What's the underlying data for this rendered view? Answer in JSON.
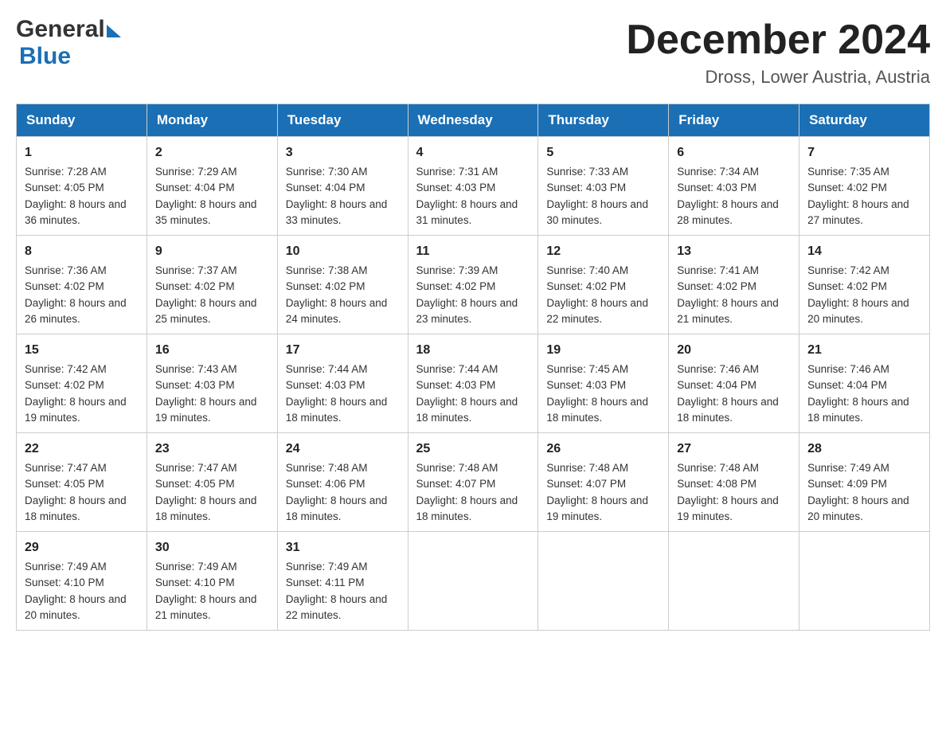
{
  "header": {
    "logo_general": "General",
    "logo_blue": "Blue",
    "title": "December 2024",
    "subtitle": "Dross, Lower Austria, Austria"
  },
  "days": [
    "Sunday",
    "Monday",
    "Tuesday",
    "Wednesday",
    "Thursday",
    "Friday",
    "Saturday"
  ],
  "weeks": [
    [
      {
        "num": "1",
        "sunrise": "7:28 AM",
        "sunset": "4:05 PM",
        "daylight": "8 hours and 36 minutes."
      },
      {
        "num": "2",
        "sunrise": "7:29 AM",
        "sunset": "4:04 PM",
        "daylight": "8 hours and 35 minutes."
      },
      {
        "num": "3",
        "sunrise": "7:30 AM",
        "sunset": "4:04 PM",
        "daylight": "8 hours and 33 minutes."
      },
      {
        "num": "4",
        "sunrise": "7:31 AM",
        "sunset": "4:03 PM",
        "daylight": "8 hours and 31 minutes."
      },
      {
        "num": "5",
        "sunrise": "7:33 AM",
        "sunset": "4:03 PM",
        "daylight": "8 hours and 30 minutes."
      },
      {
        "num": "6",
        "sunrise": "7:34 AM",
        "sunset": "4:03 PM",
        "daylight": "8 hours and 28 minutes."
      },
      {
        "num": "7",
        "sunrise": "7:35 AM",
        "sunset": "4:02 PM",
        "daylight": "8 hours and 27 minutes."
      }
    ],
    [
      {
        "num": "8",
        "sunrise": "7:36 AM",
        "sunset": "4:02 PM",
        "daylight": "8 hours and 26 minutes."
      },
      {
        "num": "9",
        "sunrise": "7:37 AM",
        "sunset": "4:02 PM",
        "daylight": "8 hours and 25 minutes."
      },
      {
        "num": "10",
        "sunrise": "7:38 AM",
        "sunset": "4:02 PM",
        "daylight": "8 hours and 24 minutes."
      },
      {
        "num": "11",
        "sunrise": "7:39 AM",
        "sunset": "4:02 PM",
        "daylight": "8 hours and 23 minutes."
      },
      {
        "num": "12",
        "sunrise": "7:40 AM",
        "sunset": "4:02 PM",
        "daylight": "8 hours and 22 minutes."
      },
      {
        "num": "13",
        "sunrise": "7:41 AM",
        "sunset": "4:02 PM",
        "daylight": "8 hours and 21 minutes."
      },
      {
        "num": "14",
        "sunrise": "7:42 AM",
        "sunset": "4:02 PM",
        "daylight": "8 hours and 20 minutes."
      }
    ],
    [
      {
        "num": "15",
        "sunrise": "7:42 AM",
        "sunset": "4:02 PM",
        "daylight": "8 hours and 19 minutes."
      },
      {
        "num": "16",
        "sunrise": "7:43 AM",
        "sunset": "4:03 PM",
        "daylight": "8 hours and 19 minutes."
      },
      {
        "num": "17",
        "sunrise": "7:44 AM",
        "sunset": "4:03 PM",
        "daylight": "8 hours and 18 minutes."
      },
      {
        "num": "18",
        "sunrise": "7:44 AM",
        "sunset": "4:03 PM",
        "daylight": "8 hours and 18 minutes."
      },
      {
        "num": "19",
        "sunrise": "7:45 AM",
        "sunset": "4:03 PM",
        "daylight": "8 hours and 18 minutes."
      },
      {
        "num": "20",
        "sunrise": "7:46 AM",
        "sunset": "4:04 PM",
        "daylight": "8 hours and 18 minutes."
      },
      {
        "num": "21",
        "sunrise": "7:46 AM",
        "sunset": "4:04 PM",
        "daylight": "8 hours and 18 minutes."
      }
    ],
    [
      {
        "num": "22",
        "sunrise": "7:47 AM",
        "sunset": "4:05 PM",
        "daylight": "8 hours and 18 minutes."
      },
      {
        "num": "23",
        "sunrise": "7:47 AM",
        "sunset": "4:05 PM",
        "daylight": "8 hours and 18 minutes."
      },
      {
        "num": "24",
        "sunrise": "7:48 AM",
        "sunset": "4:06 PM",
        "daylight": "8 hours and 18 minutes."
      },
      {
        "num": "25",
        "sunrise": "7:48 AM",
        "sunset": "4:07 PM",
        "daylight": "8 hours and 18 minutes."
      },
      {
        "num": "26",
        "sunrise": "7:48 AM",
        "sunset": "4:07 PM",
        "daylight": "8 hours and 19 minutes."
      },
      {
        "num": "27",
        "sunrise": "7:48 AM",
        "sunset": "4:08 PM",
        "daylight": "8 hours and 19 minutes."
      },
      {
        "num": "28",
        "sunrise": "7:49 AM",
        "sunset": "4:09 PM",
        "daylight": "8 hours and 20 minutes."
      }
    ],
    [
      {
        "num": "29",
        "sunrise": "7:49 AM",
        "sunset": "4:10 PM",
        "daylight": "8 hours and 20 minutes."
      },
      {
        "num": "30",
        "sunrise": "7:49 AM",
        "sunset": "4:10 PM",
        "daylight": "8 hours and 21 minutes."
      },
      {
        "num": "31",
        "sunrise": "7:49 AM",
        "sunset": "4:11 PM",
        "daylight": "8 hours and 22 minutes."
      },
      null,
      null,
      null,
      null
    ]
  ],
  "labels": {
    "sunrise": "Sunrise: ",
    "sunset": "Sunset: ",
    "daylight": "Daylight: "
  }
}
